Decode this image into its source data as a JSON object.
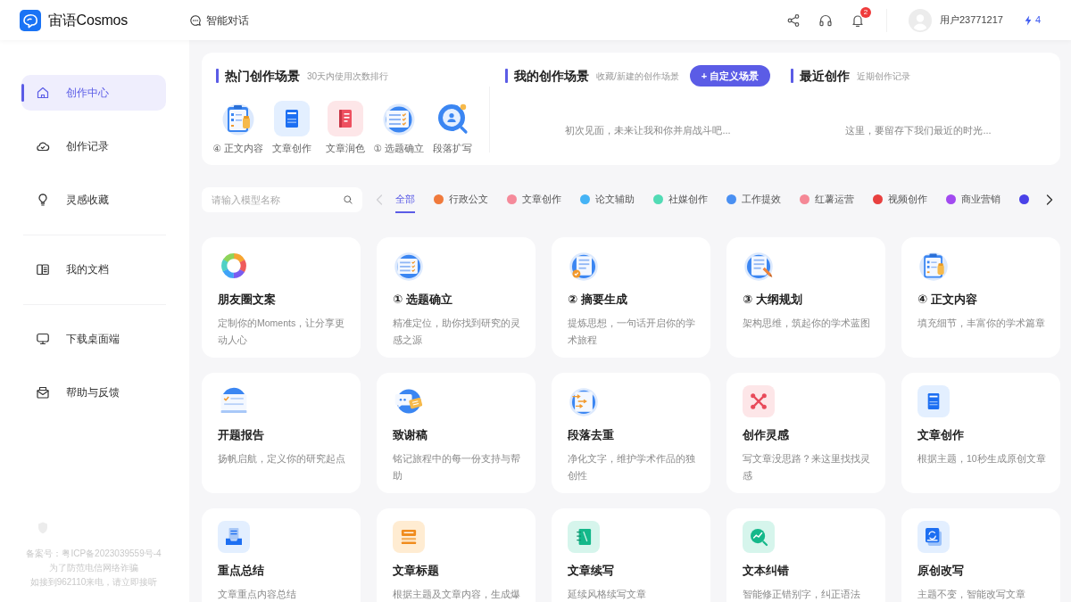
{
  "header": {
    "app_name": "宙语Cosmos",
    "nav_link": "智能对话",
    "notification_count": "2",
    "username": "用户23771217",
    "points": "4"
  },
  "sidebar": {
    "groups": [
      {
        "items": [
          {
            "label": "创作中心",
            "selected": true
          },
          {
            "label": "创作记录",
            "selected": false
          },
          {
            "label": "灵感收藏",
            "selected": false
          }
        ]
      },
      {
        "items": [
          {
            "label": "我的文档",
            "selected": false
          }
        ]
      },
      {
        "items": [
          {
            "label": "下载桌面端",
            "selected": false
          },
          {
            "label": "帮助与反馈",
            "selected": false
          }
        ]
      }
    ],
    "footer": [
      "备案号：粤ICP备2023039559号-4",
      "为了防范电信网络诈骗",
      "如接到962110来电，请立即接听"
    ]
  },
  "hot_scenes": {
    "title": "热门创作场景",
    "subtitle": "30天内使用次数排行",
    "items": [
      "④ 正文内容",
      "文章创作",
      "文章润色",
      "① 选题确立",
      "段落扩写"
    ]
  },
  "my_scenes": {
    "title": "我的创作场景",
    "subtitle": "收藏/新建的创作场景",
    "button": "+ 自定义场景",
    "empty_text": "初次见面，未来让我和你并肩战斗吧..."
  },
  "recent": {
    "title": "最近创作",
    "subtitle": "近期创作记录",
    "empty_text": "这里，要留存下我们最近的时光..."
  },
  "filter": {
    "search": {
      "placeholder": "请输入模型名称"
    },
    "tabs": [
      {
        "label": "全部",
        "selected": true
      },
      {
        "label": "行政公文",
        "selected": false,
        "color": "#f07a3c"
      },
      {
        "label": "文章创作",
        "selected": false,
        "color": "#f58a9a"
      },
      {
        "label": "论文辅助",
        "selected": false,
        "color": "#45b3f5"
      },
      {
        "label": "社媒创作",
        "selected": false,
        "color": "#52dbb5"
      },
      {
        "label": "工作提效",
        "selected": false,
        "color": "#4a90f2"
      },
      {
        "label": "红薯运营",
        "selected": false,
        "color": "#f58896"
      },
      {
        "label": "视频创作",
        "selected": false,
        "color": "#e8403f"
      },
      {
        "label": "商业营销",
        "selected": false,
        "color": "#a24af0"
      },
      {
        "selected": false,
        "color": "#4a42e8"
      }
    ]
  },
  "cards": [
    {
      "title": "朋友圈文案",
      "description": "定制你的Moments，让分享更动人心"
    },
    {
      "title": "① 选题确立",
      "description": "精准定位，助你找到研究的灵感之源"
    },
    {
      "title": "② 摘要生成",
      "description": "提炼思想，一句话开启你的学术旅程"
    },
    {
      "title": "③ 大纲规划",
      "description": "架构思维，筑起你的学术蓝图"
    },
    {
      "title": "④ 正文内容",
      "description": "填充细节，丰富你的学术篇章"
    },
    {
      "title": "开题报告",
      "description": "扬帆启航，定义你的研究起点"
    },
    {
      "title": "致谢稿",
      "description": "铭记旅程中的每一份支持与帮助"
    },
    {
      "title": "段落去重",
      "description": "净化文字，维护学术作品的独创性"
    },
    {
      "title": "创作灵感",
      "description": "写文章没思路？来这里找找灵感"
    },
    {
      "title": "文章创作",
      "description": "根据主题，10秒生成原创文章"
    },
    {
      "title": "重点总结",
      "description": "文章重点内容总结"
    },
    {
      "title": "文章标题",
      "description": "根据主题及文章内容，生成爆"
    },
    {
      "title": "文章续写",
      "description": "延续风格续写文章"
    },
    {
      "title": "文本纠错",
      "description": "智能修正错别字，纠正语法"
    },
    {
      "title": "原创改写",
      "description": "主题不变，智能改写文章"
    }
  ]
}
